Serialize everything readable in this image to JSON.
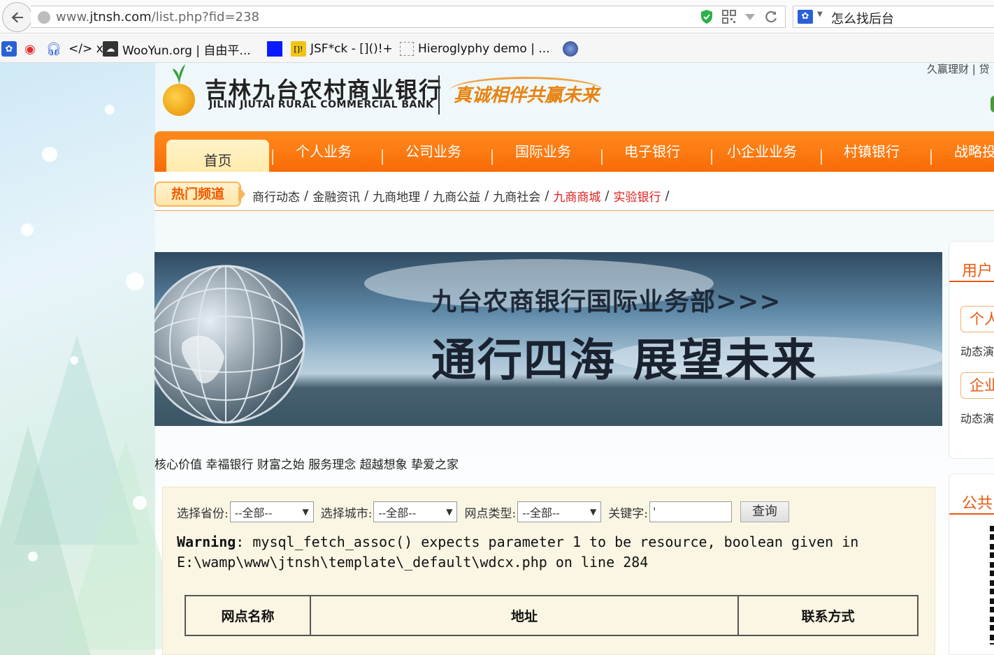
{
  "browser": {
    "url_prefix": "www.",
    "url_domain": "jtnsh.com",
    "url_path": "/list.php?fid=238",
    "search_text": "怎么找后台",
    "bookmarks": [
      {
        "icon": "paw-icon",
        "label": ""
      },
      {
        "icon": "weibo-icon",
        "label": ""
      },
      {
        "icon": "headphones-icon",
        "label": ""
      },
      {
        "icon": "code-icon",
        "label": "</> x"
      },
      {
        "icon": "wooyun-icon",
        "label": "WooYun.org | 自由平..."
      },
      {
        "icon": "blue-square-icon",
        "label": ""
      },
      {
        "icon": "jsfuck-icon",
        "label": "JSF*ck - []()!+"
      },
      {
        "icon": "blank-page-icon",
        "label": "Hieroglyphy demo | ..."
      },
      {
        "icon": "tor-icon",
        "label": ""
      }
    ]
  },
  "site": {
    "logo_cn": "吉林九台农村商业银行",
    "logo_en": "JILIN JIUTAI RURAL COMMERCIAL BANK",
    "slogan": "真诚相伴共赢未来",
    "top_links": "久赢理财 | 贷",
    "nav": {
      "home": "首页",
      "items": [
        "个人业务",
        "公司业务",
        "国际业务",
        "电子银行",
        "小企业业务",
        "村镇银行",
        "战略投"
      ]
    },
    "hot": {
      "badge": "热门频道",
      "links": [
        {
          "label": "商行动态",
          "red": false
        },
        {
          "label": "金融资讯",
          "red": false
        },
        {
          "label": "九商地理",
          "red": false
        },
        {
          "label": "九商公益",
          "red": false
        },
        {
          "label": "九商社会",
          "red": false
        },
        {
          "label": "九商商城",
          "red": true
        },
        {
          "label": "实验银行",
          "red": true
        }
      ],
      "separator": "/"
    },
    "banner": {
      "title": "九台农商银行国际业务部>>>",
      "headline": "通行四海  展望未来"
    },
    "values_text": "核心价值 幸福银行 财富之始 服务理念 超越想象 挚爱之家",
    "search_form": {
      "province_label": "选择省份:",
      "province_value": "--全部--",
      "city_label": "选择城市:",
      "city_value": "--全部--",
      "type_label": "网点类型:",
      "type_value": "--全部--",
      "keyword_label": "关键字:",
      "keyword_value": "'",
      "query_button": "查询"
    },
    "warning": {
      "label": "Warning",
      "message": ": mysql_fetch_assoc() expects parameter 1 to be resource, boolean given in",
      "path": "E:\\wamp\\www\\jtnsh\\template\\_default\\wdcx.php",
      "on_line": " on line ",
      "line": "284"
    },
    "table_headers": [
      "网点名称",
      "地址",
      "联系方式"
    ],
    "sidebar": {
      "user_title": "用户",
      "personal_btn": "个人",
      "personal_sub": "动态演",
      "corporate_btn": "企业",
      "corporate_sub": "动态演",
      "notice_title": "公共"
    }
  },
  "colors": {
    "nav_orange": "#f96b06",
    "hot_red": "#e02020",
    "accent_orange": "#e85a10"
  }
}
